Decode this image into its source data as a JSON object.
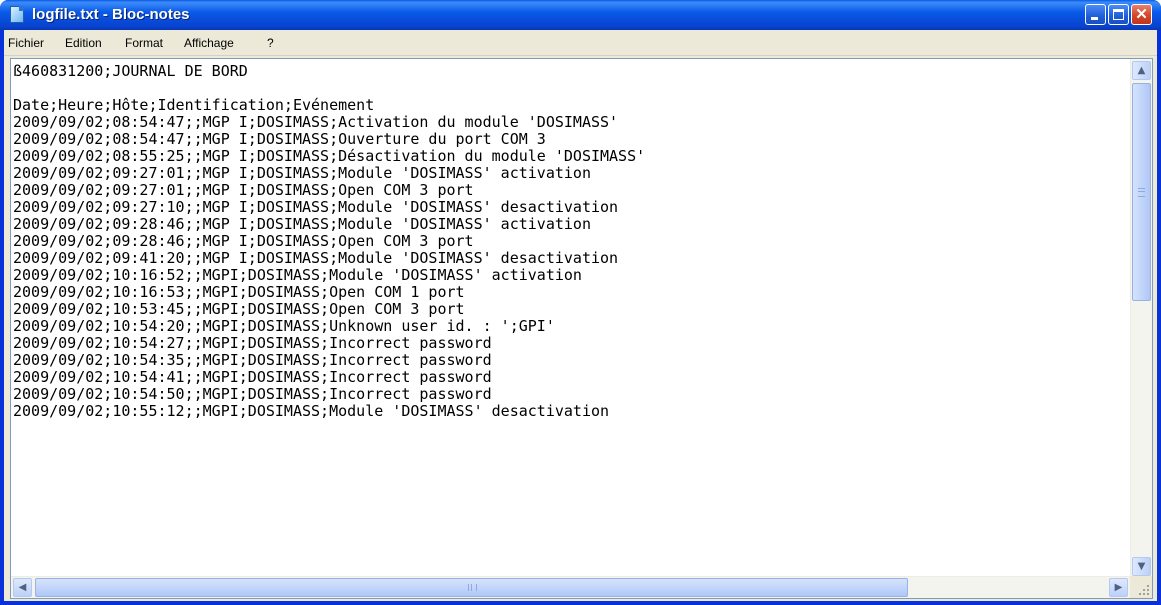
{
  "window": {
    "title": "logfile.txt - Bloc-notes",
    "controls": {
      "minimize": "",
      "maximize": "",
      "close": "✕"
    }
  },
  "menu": {
    "items": [
      "Fichier",
      "Edition",
      "Format",
      "Affichage",
      "?"
    ]
  },
  "document": {
    "lines": [
      "ß460831200;JOURNAL DE BORD",
      "",
      "Date;Heure;Hôte;Identification;Evénement",
      "2009/09/02;08:54:47;;MGP I;DOSIMASS;Activation du module 'DOSIMASS'",
      "2009/09/02;08:54:47;;MGP I;DOSIMASS;Ouverture du port COM 3",
      "2009/09/02;08:55:25;;MGP I;DOSIMASS;Désactivation du module 'DOSIMASS'",
      "2009/09/02;09:27:01;;MGP I;DOSIMASS;Module 'DOSIMASS' activation",
      "2009/09/02;09:27:01;;MGP I;DOSIMASS;Open COM 3 port",
      "2009/09/02;09:27:10;;MGP I;DOSIMASS;Module 'DOSIMASS' desactivation",
      "2009/09/02;09:28:46;;MGP I;DOSIMASS;Module 'DOSIMASS' activation",
      "2009/09/02;09:28:46;;MGP I;DOSIMASS;Open COM 3 port",
      "2009/09/02;09:41:20;;MGP I;DOSIMASS;Module 'DOSIMASS' desactivation",
      "2009/09/02;10:16:52;;MGPI;DOSIMASS;Module 'DOSIMASS' activation",
      "2009/09/02;10:16:53;;MGPI;DOSIMASS;Open COM 1 port",
      "2009/09/02;10:53:45;;MGPI;DOSIMASS;Open COM 3 port",
      "2009/09/02;10:54:20;;MGPI;DOSIMASS;Unknown user id. : ';GPI'",
      "2009/09/02;10:54:27;;MGPI;DOSIMASS;Incorrect password",
      "2009/09/02;10:54:35;;MGPI;DOSIMASS;Incorrect password",
      "2009/09/02;10:54:41;;MGPI;DOSIMASS;Incorrect password",
      "2009/09/02;10:54:50;;MGPI;DOSIMASS;Incorrect password",
      "2009/09/02;10:55:12;;MGPI;DOSIMASS;Module 'DOSIMASS' desactivation"
    ]
  },
  "scrollbars": {
    "vertical": {
      "up": "▲",
      "down": "▼"
    },
    "horizontal": {
      "left": "◀",
      "right": "▶"
    }
  },
  "colors": {
    "title_bar": "#0a5ae8",
    "chrome": "#ece9d8",
    "close_button": "#d4452a"
  }
}
